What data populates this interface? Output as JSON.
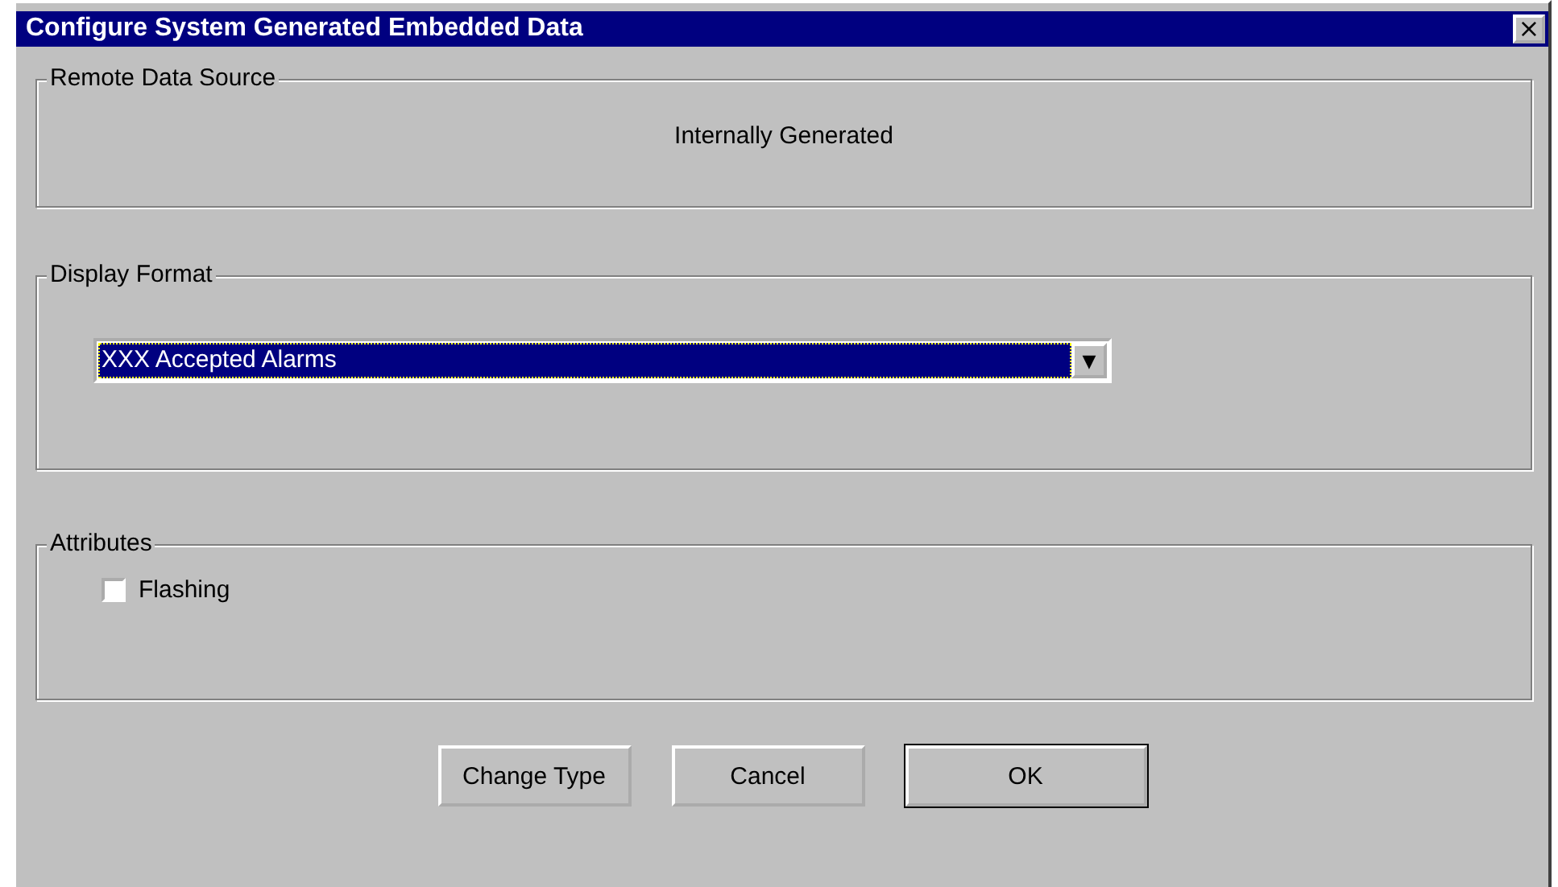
{
  "window": {
    "title": "Configure System Generated Embedded Data",
    "close": "×"
  },
  "remote_data_source": {
    "label": "Remote Data Source",
    "value": "Internally Generated"
  },
  "display_format": {
    "label": "Display Format",
    "value": "XXX Accepted Alarms",
    "arrow": "▼"
  },
  "attributes": {
    "label": "Attributes",
    "options": [
      {
        "label": "Flashing",
        "checked": false
      }
    ]
  },
  "buttons": [
    {
      "label": "Change Type",
      "default": false
    },
    {
      "label": "Cancel",
      "default": false
    },
    {
      "label": "OK",
      "default": true
    }
  ]
}
